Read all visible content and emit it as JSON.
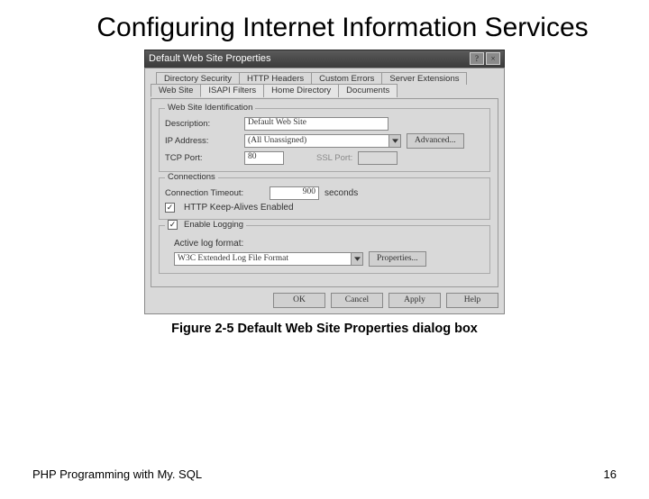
{
  "slide": {
    "title": "Configuring Internet Information Services",
    "caption": "Figure 2-5 Default Web Site Properties dialog box",
    "footer": "PHP Programming with My. SQL",
    "page": "16"
  },
  "dialog": {
    "title": "Default Web Site Properties",
    "help_btn": "?",
    "close_btn": "×",
    "tabs_back": [
      "Directory Security",
      "HTTP Headers",
      "Custom Errors",
      "Server Extensions"
    ],
    "tabs_front": [
      "Web Site",
      "ISAPI Filters",
      "Home Directory",
      "Documents"
    ],
    "group_ident": {
      "legend": "Web Site Identification",
      "desc_label": "Description:",
      "desc_value": "Default Web Site",
      "ip_label": "IP Address:",
      "ip_value": "(All Unassigned)",
      "advanced": "Advanced...",
      "tcp_label": "TCP Port:",
      "tcp_value": "80",
      "ssl_label": "SSL Port:",
      "ssl_value": ""
    },
    "group_conn": {
      "legend": "Connections",
      "timeout_label": "Connection Timeout:",
      "timeout_value": "900",
      "timeout_unit": "seconds",
      "keepalive_label": "HTTP Keep-Alives Enabled"
    },
    "group_log": {
      "enable_label": "Enable Logging",
      "format_label": "Active log format:",
      "format_value": "W3C Extended Log File Format",
      "properties": "Properties..."
    },
    "buttons": {
      "ok": "OK",
      "cancel": "Cancel",
      "apply": "Apply",
      "help": "Help"
    }
  }
}
